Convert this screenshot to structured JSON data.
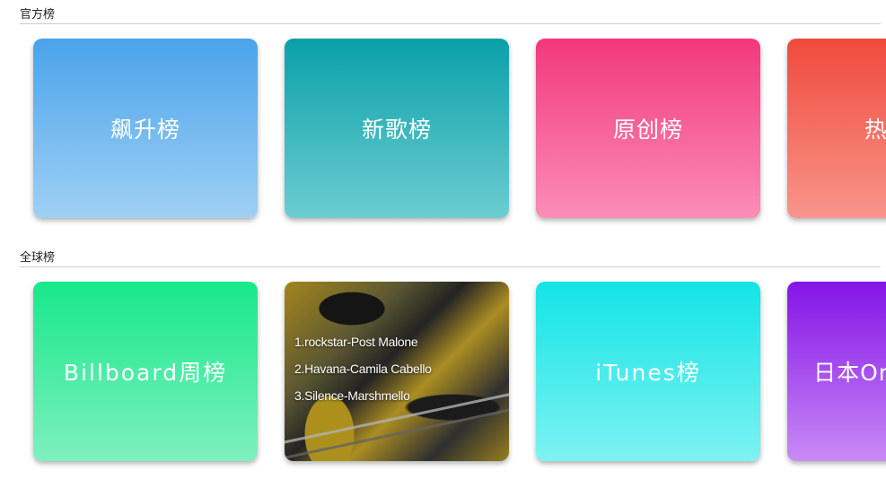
{
  "sections": [
    {
      "title": "官方榜",
      "cards": [
        {
          "label": "飙升榜"
        },
        {
          "label": "新歌榜"
        },
        {
          "label": "原创榜"
        },
        {
          "label": "热歌榜"
        }
      ]
    },
    {
      "title": "全球榜",
      "cards": [
        {
          "label": "Billboard周榜"
        },
        {
          "tracks": [
            "1.rockstar-Post Malone",
            "2.Havana-Camila Cabello",
            "3.Silence-Marshmello"
          ]
        },
        {
          "label": "iTunes榜"
        },
        {
          "label": "日本Oricon周榜"
        }
      ]
    }
  ],
  "colors": {
    "soaring": [
      "#4aa3ea",
      "#9fd0f4"
    ],
    "new": [
      "#0aa0a8",
      "#6ccdd2"
    ],
    "original": [
      "#f2387a",
      "#fb8db9"
    ],
    "hot": [
      "#ef4a3c",
      "#f9958a"
    ],
    "billboard": [
      "#17e88b",
      "#7ef0bf"
    ],
    "itunes": [
      "#12e4e6",
      "#7ef2f2"
    ],
    "japan": [
      "#8414e8",
      "#c98af5"
    ]
  }
}
